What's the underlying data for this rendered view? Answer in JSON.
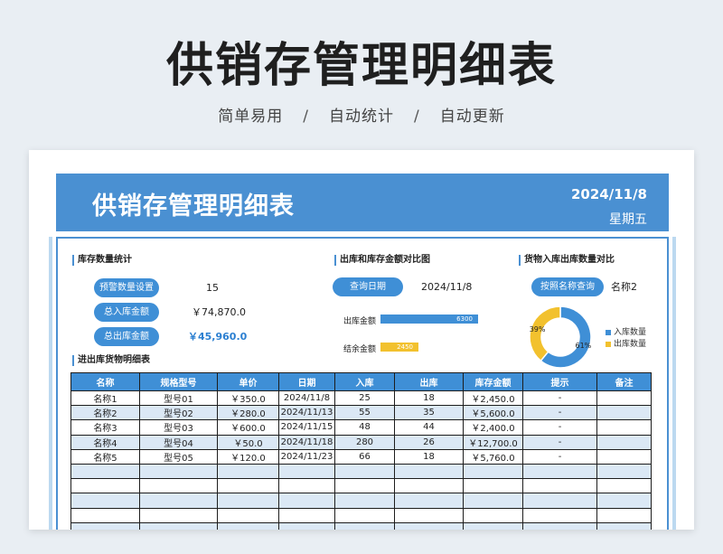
{
  "header": {
    "title": "供销存管理明细表",
    "subtitle_parts": [
      "简单易用",
      "自动统计",
      "自动更新"
    ],
    "separator": "/"
  },
  "banner": {
    "title": "供销存管理明细表",
    "date": "2024/11/8",
    "weekday": "星期五"
  },
  "stock_stats": {
    "title": "库存数量统计",
    "rows": [
      {
        "label": "预警数量设置",
        "value": "15"
      },
      {
        "label": "总入库金额",
        "value": "￥74,870.0"
      },
      {
        "label": "总出库金额",
        "value": "￥45,960.0"
      }
    ]
  },
  "compare": {
    "title": "出库和库存金额对比图",
    "query_label": "查询日期",
    "query_value": "2024/11/8"
  },
  "goods": {
    "title": "货物入库出库数量对比",
    "query_label": "按照名称查询",
    "query_value": "名称2"
  },
  "colors": {
    "accent": "#3f8fd6",
    "banner": "#4a90d2",
    "bar_out": "#3f8fd6",
    "bar_stock": "#f2c12e",
    "alt_row": "#dbe8f5"
  },
  "chart_data": [
    {
      "type": "bar",
      "orientation": "horizontal",
      "categories": [
        "出库金额",
        "结余金额"
      ],
      "values": [
        6300,
        2450
      ],
      "xlim": [
        0,
        14000
      ]
    },
    {
      "type": "pie",
      "style": "donut",
      "labels": [
        "入库数量",
        "出库数量"
      ],
      "values": [
        61,
        39
      ],
      "value_labels": [
        "61%",
        "39%"
      ],
      "colors": [
        "#3f8fd6",
        "#f2c12e"
      ],
      "legend": "right"
    }
  ],
  "detail": {
    "title": "进出库货物明细表",
    "columns": [
      "名称",
      "规格型号",
      "单价",
      "日期",
      "入库",
      "出库",
      "库存金额",
      "提示",
      "备注"
    ],
    "rows": [
      [
        "名称1",
        "型号01",
        "￥350.0",
        "2024/11/8",
        "25",
        "18",
        "￥2,450.0",
        "-",
        ""
      ],
      [
        "名称2",
        "型号02",
        "￥280.0",
        "2024/11/13",
        "55",
        "35",
        "￥5,600.0",
        "-",
        ""
      ],
      [
        "名称3",
        "型号03",
        "￥600.0",
        "2024/11/15",
        "48",
        "44",
        "￥2,400.0",
        "-",
        ""
      ],
      [
        "名称4",
        "型号04",
        "￥50.0",
        "2024/11/18",
        "280",
        "26",
        "￥12,700.0",
        "-",
        ""
      ],
      [
        "名称5",
        "型号05",
        "￥120.0",
        "2024/11/23",
        "66",
        "18",
        "￥5,760.0",
        "-",
        ""
      ],
      [
        "",
        "",
        "",
        "",
        "",
        "",
        "",
        "",
        ""
      ],
      [
        "",
        "",
        "",
        "",
        "",
        "",
        "",
        "",
        ""
      ],
      [
        "",
        "",
        "",
        "",
        "",
        "",
        "",
        "",
        ""
      ],
      [
        "",
        "",
        "",
        "",
        "",
        "",
        "",
        "",
        ""
      ],
      [
        "",
        "",
        "",
        "",
        "",
        "",
        "",
        "",
        ""
      ]
    ]
  }
}
